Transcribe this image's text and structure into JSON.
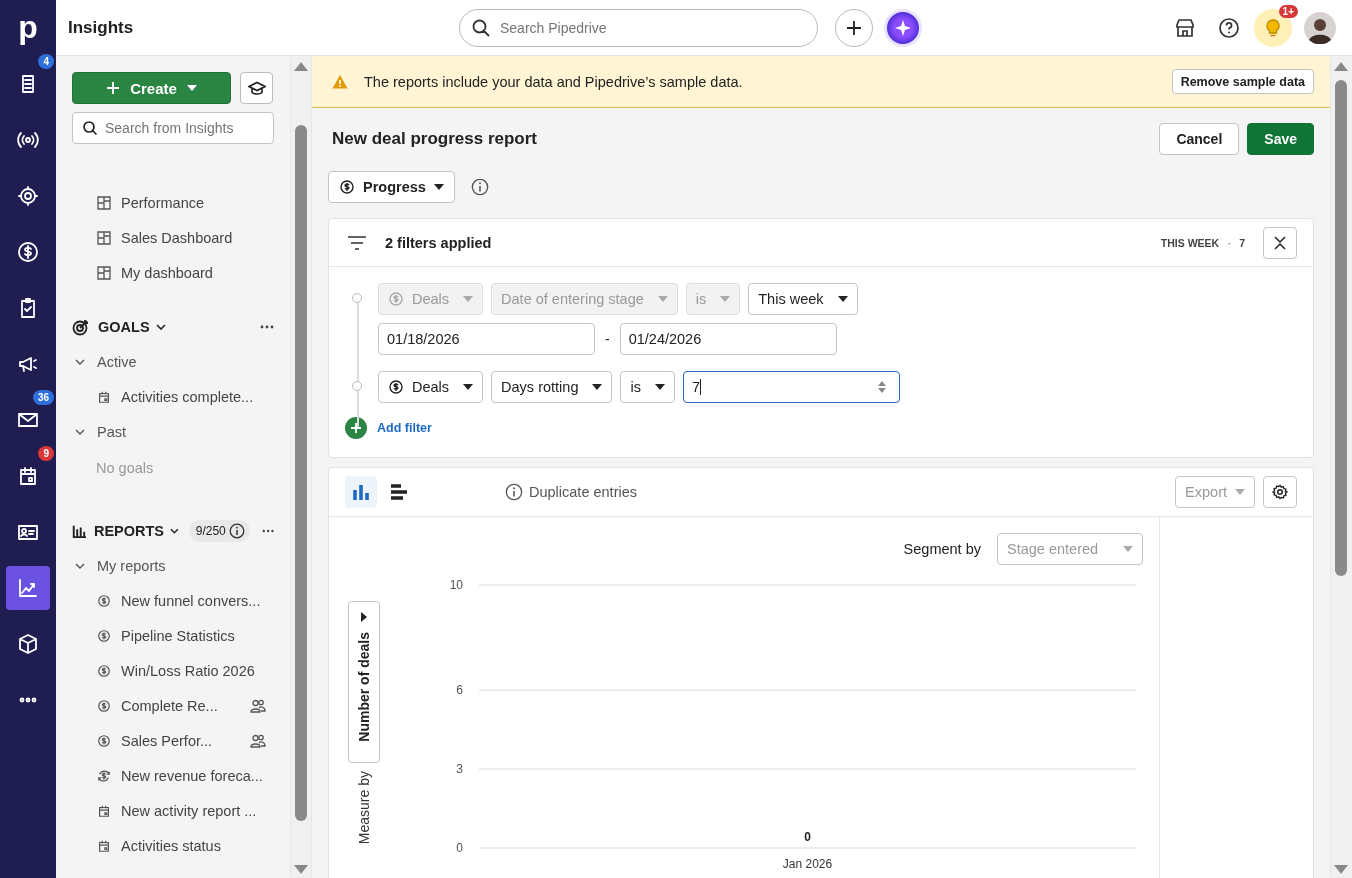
{
  "app": {
    "logo": "p",
    "page_title": "Insights"
  },
  "search": {
    "placeholder": "Search Pipedrive"
  },
  "header_icons": [
    {
      "kind": "store"
    },
    {
      "kind": "help"
    },
    {
      "kind": "bulb",
      "badge": "1+"
    },
    {
      "kind": "avatar"
    }
  ],
  "rail": [
    {
      "kind": "leads",
      "badge": "4",
      "color": "#2f6fdb",
      "selected": false
    },
    {
      "kind": "radio",
      "selected": false
    },
    {
      "kind": "target",
      "selected": false
    },
    {
      "kind": "dollar",
      "selected": false
    },
    {
      "kind": "clipboard",
      "selected": false
    },
    {
      "kind": "megaphone",
      "selected": false
    },
    {
      "kind": "mail",
      "badge": "36",
      "color": "#2f6fdb",
      "selected": false
    },
    {
      "kind": "calendar",
      "badge": "9",
      "color": "#d9383a",
      "selected": false
    },
    {
      "kind": "contact",
      "selected": false
    },
    {
      "kind": "chart",
      "selected": true
    },
    {
      "kind": "box",
      "selected": false
    },
    {
      "kind": "more",
      "selected": false
    }
  ],
  "sidebar": {
    "create": "Create",
    "search_placeholder": "Search from Insights",
    "dashboards": [
      "Performance",
      "Sales Dashboard",
      "My dashboard"
    ],
    "goals": {
      "title": "GOALS",
      "expanded": true,
      "groups": [
        {
          "label": "Active",
          "expanded": true,
          "items": [
            {
              "label": "Activities complete...",
              "kind": "activity"
            }
          ]
        },
        {
          "label": "Past",
          "expanded": true,
          "empty": "No goals"
        }
      ]
    },
    "reports": {
      "title": "REPORTS",
      "expanded": true,
      "count": "9/250",
      "groups": [
        {
          "label": "My reports",
          "expanded": true,
          "items": [
            {
              "label": "New funnel convers...",
              "kind": "deal",
              "shared": false
            },
            {
              "label": "Pipeline Statistics",
              "kind": "deal",
              "shared": false
            },
            {
              "label": "Win/Loss Ratio 2026",
              "kind": "deal",
              "shared": false
            },
            {
              "label": "Complete Re...",
              "kind": "deal",
              "shared": true
            },
            {
              "label": "Sales Perfor...",
              "kind": "deal",
              "shared": true
            },
            {
              "label": "New revenue foreca...",
              "kind": "forecast",
              "shared": false
            },
            {
              "label": "New activity report ...",
              "kind": "activity",
              "shared": false
            },
            {
              "label": "Activities status",
              "kind": "activity",
              "shared": false
            }
          ]
        }
      ]
    }
  },
  "banner": {
    "text": "The reports include your data and Pipedrive’s sample data.",
    "button": "Remove sample data"
  },
  "report": {
    "title": "New deal progress report",
    "cancel": "Cancel",
    "save": "Save",
    "type": "Progress"
  },
  "filters": {
    "summary": "2 filters applied",
    "period": "THIS WEEK",
    "separator": "·",
    "count": "7",
    "add": "Add filter",
    "rows": [
      {
        "fields": [
          {
            "label": "Deals",
            "icon": true,
            "disabled": true
          },
          {
            "label": "Date of entering stage",
            "icon": false,
            "disabled": true
          },
          {
            "label": "is",
            "icon": false,
            "disabled": true
          },
          {
            "label": "This week",
            "icon": false,
            "disabled": false
          }
        ],
        "range": [
          "01/18/2026",
          "01/24/2026"
        ],
        "separator": "-"
      },
      {
        "fields": [
          {
            "label": "Deals",
            "icon": true,
            "disabled": false
          },
          {
            "label": "Days rotting",
            "icon": false,
            "disabled": false
          },
          {
            "label": "is",
            "icon": false,
            "disabled": false
          }
        ],
        "value": "7"
      }
    ]
  },
  "chart_panel": {
    "views": [
      {
        "kind": "column",
        "selected": true
      },
      {
        "kind": "bar",
        "selected": false
      }
    ],
    "duplicate": "Duplicate entries",
    "export": {
      "label": "Export",
      "disabled": true
    },
    "segment_label": "Segment by",
    "segment": {
      "label": "Stage entered",
      "disabled": true
    },
    "measure_label": "Measure by",
    "measure": "Number of deals",
    "chart_data": {
      "type": "bar",
      "categories": [
        "Jan 2026"
      ],
      "values": [
        0
      ],
      "ylim": [
        0,
        10
      ],
      "yticks": [
        0,
        3,
        6,
        10
      ],
      "data_labels": true
    }
  }
}
